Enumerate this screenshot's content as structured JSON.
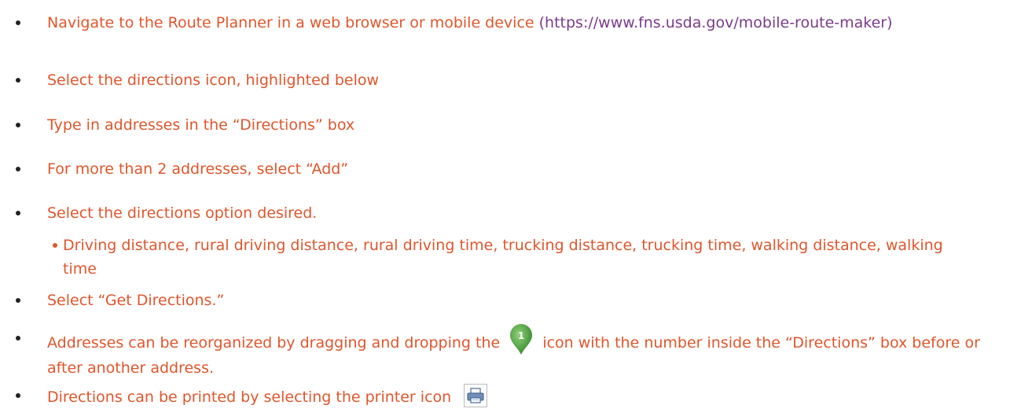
{
  "items": [
    {
      "text": "Navigate to the Route Planner in a web browser or mobile device ",
      "link": "(https://www.fns.usda.gov/mobile-route-maker)"
    },
    {
      "text": "Select the directions icon, highlighted below"
    },
    {
      "text": "Type in addresses in the “Directions” box"
    },
    {
      "text": "For more than 2 addresses, select “Add”"
    },
    {
      "text": "Select the directions option desired."
    },
    {
      "text": "Driving distance, rural driving distance, rural driving time, trucking distance, trucking time, walking distance, walking time"
    },
    {
      "text": "Select “Get Directions.”"
    },
    {
      "text_before": "Addresses can be reorganized by dragging and dropping the",
      "text_after": "icon with the number inside the “Directions” box before or after another address.",
      "pin_number": "1"
    },
    {
      "text": "Directions can be printed by selecting the printer icon"
    }
  ],
  "colors": {
    "text": "#e0562c",
    "link": "#7b3b8c",
    "pin": "#4a9a3c"
  },
  "icons": {
    "pin": "map-pin-icon",
    "printer": "printer-icon"
  }
}
